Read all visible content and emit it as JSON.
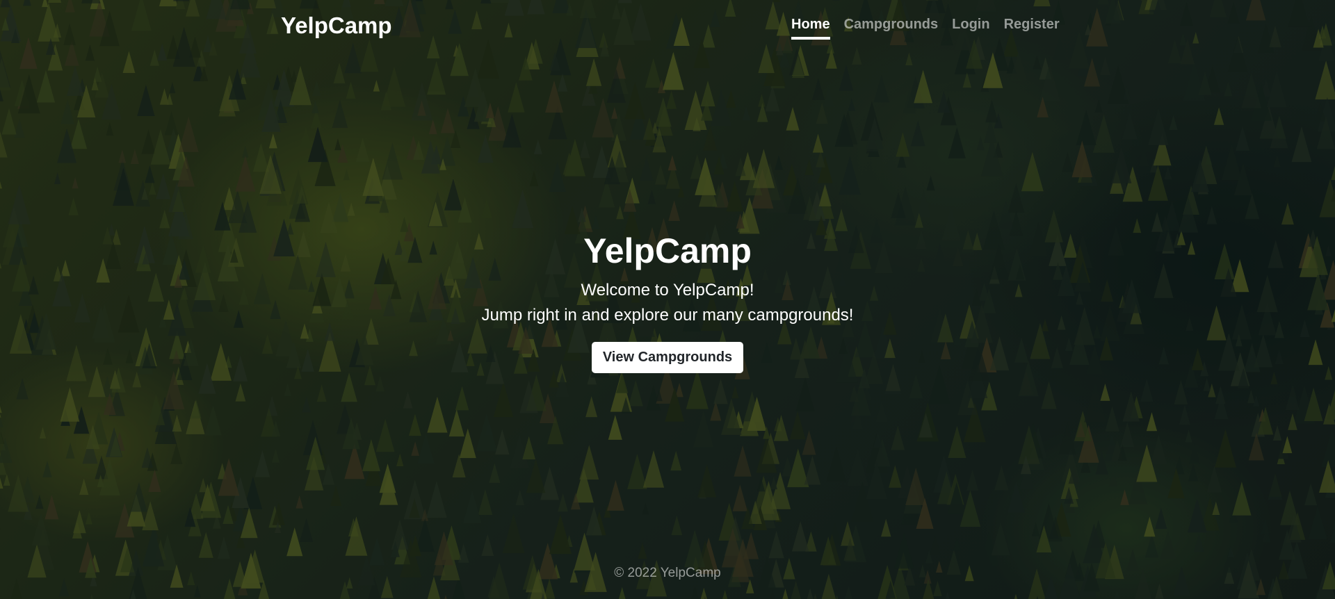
{
  "navbar": {
    "brand": "YelpCamp",
    "links": [
      {
        "label": "Home",
        "active": true
      },
      {
        "label": "Campgrounds",
        "active": false
      },
      {
        "label": "Login",
        "active": false
      },
      {
        "label": "Register",
        "active": false
      }
    ]
  },
  "hero": {
    "title": "YelpCamp",
    "line1": "Welcome to YelpCamp!",
    "line2": "Jump right in and explore our many campgrounds!",
    "button_label": "View Campgrounds"
  },
  "footer": {
    "text": "© 2022 YelpCamp"
  },
  "colors": {
    "text": "#ffffff",
    "muted_text": "#9aa39a",
    "button_bg": "#ffffff",
    "button_text": "#212529",
    "forest_dark": "#1c2b25",
    "forest_light": "#6b7a2e"
  }
}
